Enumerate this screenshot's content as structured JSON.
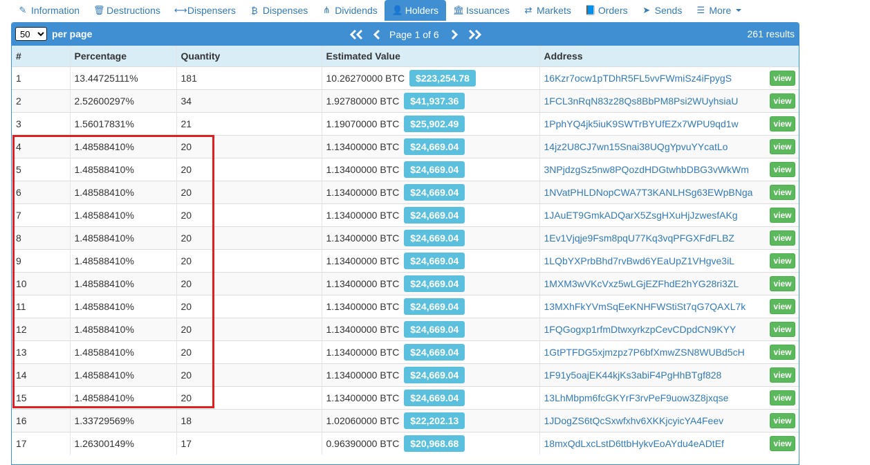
{
  "tabs": [
    {
      "label": "Information",
      "icon": "pencil-icon",
      "glyph": "✎",
      "active": false
    },
    {
      "label": "Destructions",
      "icon": "trash-icon",
      "glyph": "🗑",
      "active": false
    },
    {
      "label": "Dispensers",
      "icon": "arrows-horizontal-icon",
      "glyph": "⟷",
      "active": false
    },
    {
      "label": "Dispenses",
      "icon": "bitcoin-icon",
      "glyph": "₿",
      "active": false
    },
    {
      "label": "Dividends",
      "icon": "sitemap-icon",
      "glyph": "⋔",
      "active": false
    },
    {
      "label": "Holders",
      "icon": "user-icon",
      "glyph": "👤",
      "active": true
    },
    {
      "label": "Issuances",
      "icon": "bank-icon",
      "glyph": "🏛",
      "active": false
    },
    {
      "label": "Markets",
      "icon": "exchange-icon",
      "glyph": "⇄",
      "active": false
    },
    {
      "label": "Orders",
      "icon": "book-icon",
      "glyph": "📘",
      "active": false
    },
    {
      "label": "Sends",
      "icon": "paper-plane-icon",
      "glyph": "➤",
      "active": false
    },
    {
      "label": "More",
      "icon": "list-icon",
      "glyph": "☰",
      "active": false
    }
  ],
  "toolbar": {
    "per_page_value": "50",
    "per_page_label": "per page",
    "page_label": "Page 1 of 6",
    "results": "261 results"
  },
  "columns": [
    "#",
    "Percentage",
    "Quantity",
    "Estimated Value",
    "Address"
  ],
  "view_label": "view",
  "rows": [
    {
      "n": "1",
      "pct": "13.44725111%",
      "qty": "181",
      "btc": "10.26270000 BTC",
      "usd": "$223,254.78",
      "addr": "16Kzr7ocw1pTDhR5FL5vvFWmiSz4iFpygS"
    },
    {
      "n": "2",
      "pct": "2.52600297%",
      "qty": "34",
      "btc": "1.92780000 BTC",
      "usd": "$41,937.36",
      "addr": "1FCL3nRqN83z28Qs8BbPM8Psi2WUyhsiaU"
    },
    {
      "n": "3",
      "pct": "1.56017831%",
      "qty": "21",
      "btc": "1.19070000 BTC",
      "usd": "$25,902.49",
      "addr": "1PphYQ4jk5iuK9SWTrBYUfEZx7WPU9qd1w"
    },
    {
      "n": "4",
      "pct": "1.48588410%",
      "qty": "20",
      "btc": "1.13400000 BTC",
      "usd": "$24,669.04",
      "addr": "14jz2U8CJ7wn15Snai38UQgYpvuYYcatLo"
    },
    {
      "n": "5",
      "pct": "1.48588410%",
      "qty": "20",
      "btc": "1.13400000 BTC",
      "usd": "$24,669.04",
      "addr": "3NPjdzgSz5nw8PQozdHDGtwhbDBG3vWkWm"
    },
    {
      "n": "6",
      "pct": "1.48588410%",
      "qty": "20",
      "btc": "1.13400000 BTC",
      "usd": "$24,669.04",
      "addr": "1NVatPHLDNopCWA7T3KANLHSg63EWpBNga"
    },
    {
      "n": "7",
      "pct": "1.48588410%",
      "qty": "20",
      "btc": "1.13400000 BTC",
      "usd": "$24,669.04",
      "addr": "1JAuET9GmkADQarX5ZsgHXuHjJzwesfAKg"
    },
    {
      "n": "8",
      "pct": "1.48588410%",
      "qty": "20",
      "btc": "1.13400000 BTC",
      "usd": "$24,669.04",
      "addr": "1Ev1Vjqje9Fsm8pqU77Kq3vqPFGXFdFLBZ"
    },
    {
      "n": "9",
      "pct": "1.48588410%",
      "qty": "20",
      "btc": "1.13400000 BTC",
      "usd": "$24,669.04",
      "addr": "1LQbYXPrbBhd7rvBwd6YEaUpZ1VHgve3iL"
    },
    {
      "n": "10",
      "pct": "1.48588410%",
      "qty": "20",
      "btc": "1.13400000 BTC",
      "usd": "$24,669.04",
      "addr": "1MXM3wVKcVxz5wLGjEZFhdE2hYG28ri3ZL"
    },
    {
      "n": "11",
      "pct": "1.48588410%",
      "qty": "20",
      "btc": "1.13400000 BTC",
      "usd": "$24,669.04",
      "addr": "13MXhFkYVmSqEeKNHFWStiSt7qG7QAXL7k"
    },
    {
      "n": "12",
      "pct": "1.48588410%",
      "qty": "20",
      "btc": "1.13400000 BTC",
      "usd": "$24,669.04",
      "addr": "1FQGogxp1rfmDtwxyrkzpCevCDpdCN9KYY"
    },
    {
      "n": "13",
      "pct": "1.48588410%",
      "qty": "20",
      "btc": "1.13400000 BTC",
      "usd": "$24,669.04",
      "addr": "1GtPTFDG5xjmzpz7P6bfXmwZSN8WUBd5cH"
    },
    {
      "n": "14",
      "pct": "1.48588410%",
      "qty": "20",
      "btc": "1.13400000 BTC",
      "usd": "$24,669.04",
      "addr": "1F91y5oajEK44kjKs3abiF4PgHhBTgf828"
    },
    {
      "n": "15",
      "pct": "1.48588410%",
      "qty": "20",
      "btc": "1.13400000 BTC",
      "usd": "$24,669.04",
      "addr": "13LhMbpm6fcGKYrF3rvPeF9uow3Z8jxqse"
    },
    {
      "n": "16",
      "pct": "1.33729569%",
      "qty": "18",
      "btc": "1.02060000 BTC",
      "usd": "$22,202.13",
      "addr": "1JDogZS6tQcSxwfxhv6XKKjcyicYA4Feev"
    },
    {
      "n": "17",
      "pct": "1.26300149%",
      "qty": "17",
      "btc": "0.96390000 BTC",
      "usd": "$20,968.68",
      "addr": "18mxQdLxcLstD6ttbHykvEoAYdu4eADtEf"
    }
  ]
}
